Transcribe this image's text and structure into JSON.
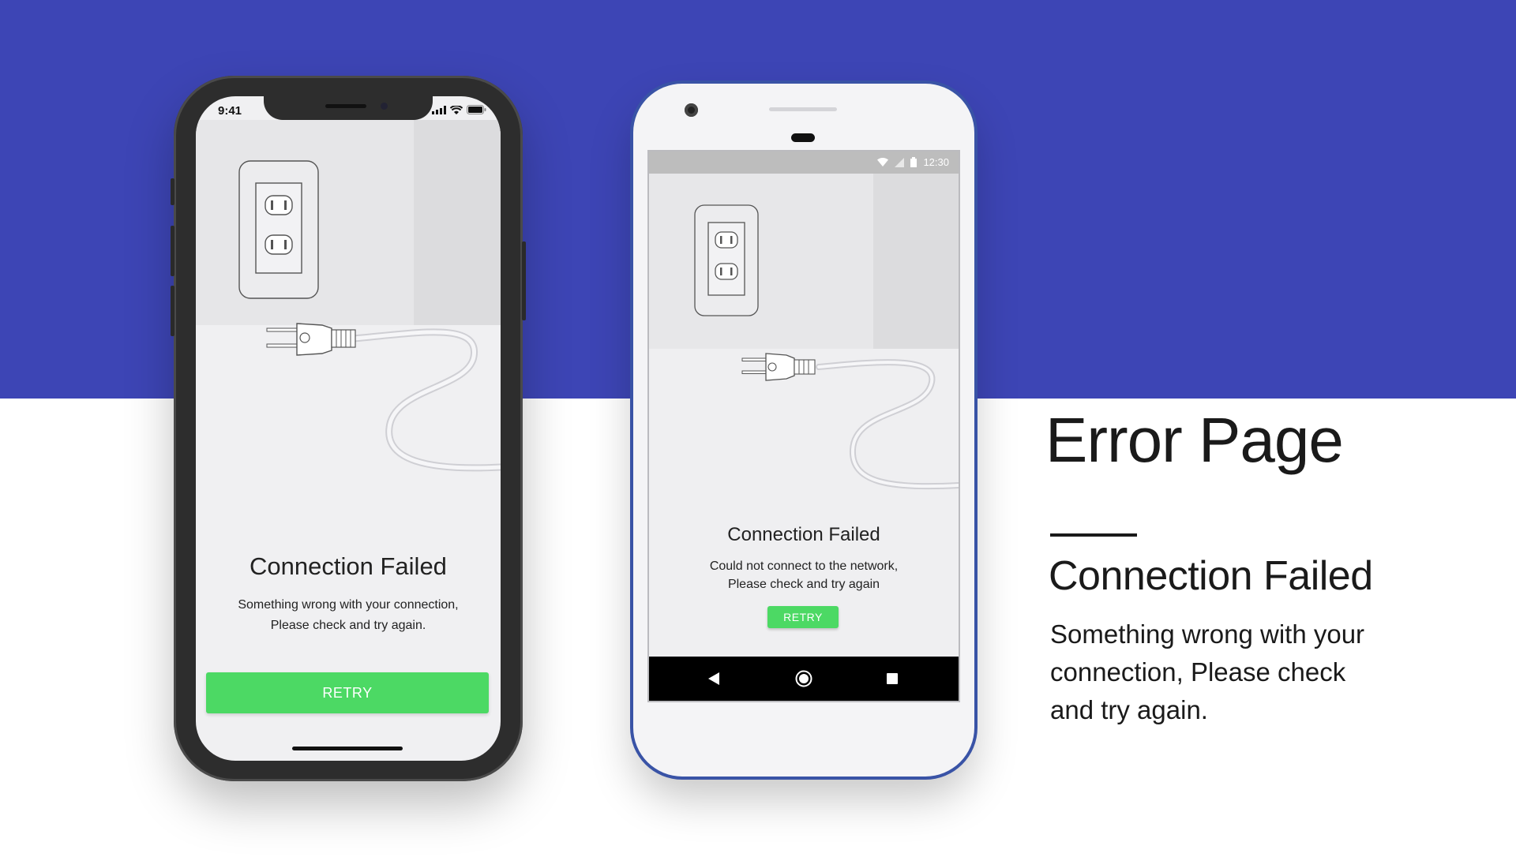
{
  "colors": {
    "band": "#3d45b5",
    "retry_green": "#4cd964",
    "iphone_body": "#2d2d2d",
    "android_frame": "#3953a6"
  },
  "iphone": {
    "status_time": "9:41",
    "status_icons": [
      "signal-icon",
      "wifi-icon",
      "battery-icon"
    ],
    "title": "Connection Failed",
    "message_line1": "Something wrong with your connection,",
    "message_line2": "Please check and try again.",
    "retry_label": "RETRY"
  },
  "android": {
    "status_time": "12:30",
    "status_icons": [
      "wifi-icon",
      "signal-icon",
      "battery-icon"
    ],
    "title": "Connection Failed",
    "message_line1": "Could not connect to the network,",
    "message_line2": "Please check and try again",
    "retry_label": "RETRY",
    "nav_icons": [
      "back-icon",
      "home-icon",
      "recents-icon"
    ]
  },
  "panel": {
    "heading": "Error Page",
    "subheading": "Connection Failed",
    "description_line1": "Something wrong with your",
    "description_line2": "connection, Please check",
    "description_line3": "and try again."
  }
}
